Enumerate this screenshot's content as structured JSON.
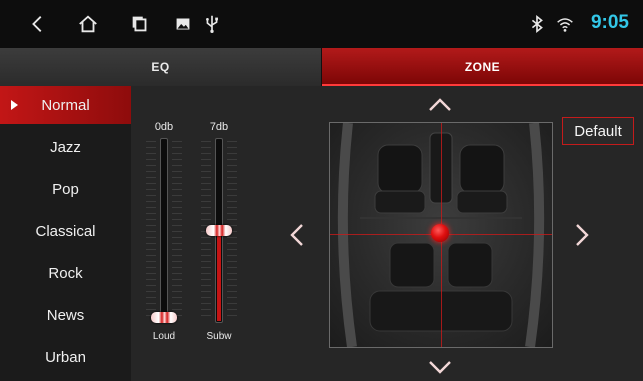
{
  "status_bar": {
    "icons": [
      "back-icon",
      "home-icon",
      "recent-apps-icon",
      "image-icon",
      "usb-icon",
      "bluetooth-icon",
      "wifi-icon"
    ],
    "time": "9:05",
    "time_color": "#33c7e8"
  },
  "tabs": [
    {
      "label": "EQ",
      "active": false
    },
    {
      "label": "ZONE",
      "active": true
    }
  ],
  "presets": {
    "selected": "Normal",
    "items": [
      "Normal",
      "Jazz",
      "Pop",
      "Classical",
      "Rock",
      "News",
      "Urban"
    ]
  },
  "sliders": [
    {
      "name": "Loud",
      "value_label": "0db",
      "level": 0.0
    },
    {
      "name": "Subw",
      "value_label": "7db",
      "level": 0.5
    }
  ],
  "zone": {
    "position": "center",
    "reset_label": "Default"
  },
  "colors": {
    "accent": "#c41414",
    "background": "#202020",
    "status_bar": "#0d0d0d"
  }
}
